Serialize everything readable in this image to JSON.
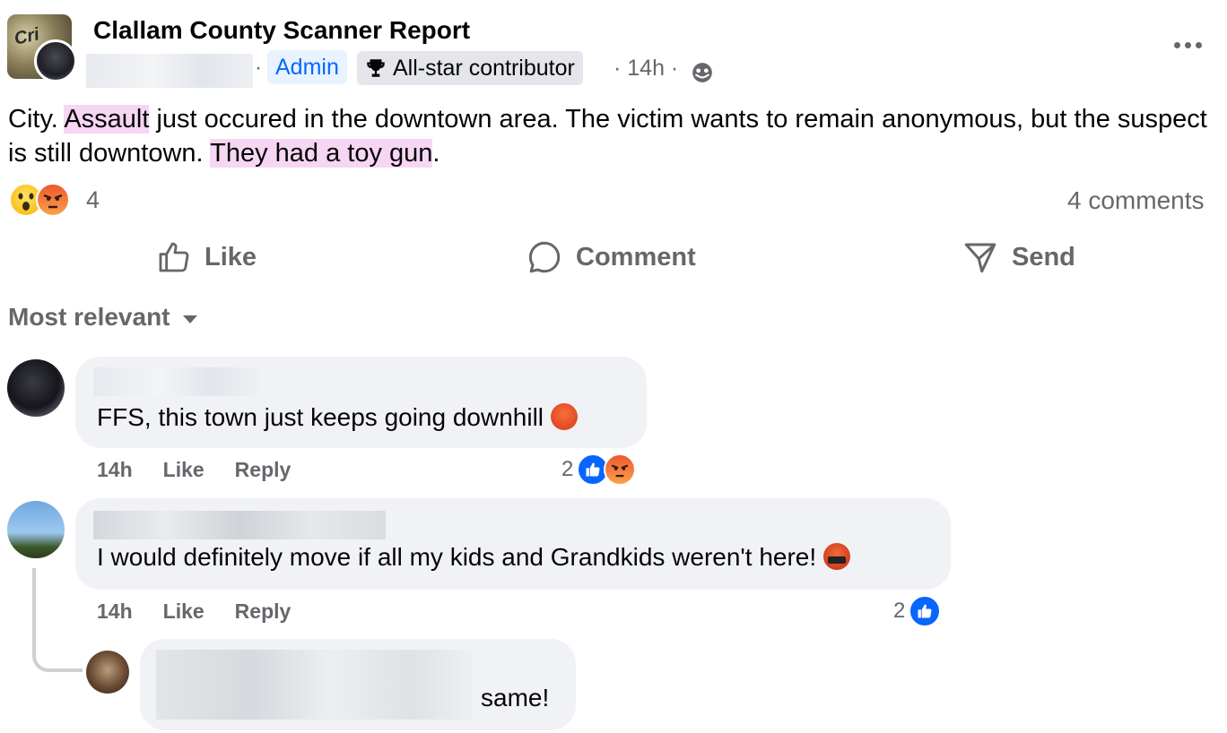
{
  "post": {
    "group_name": "Clallam County Scanner Report",
    "group_avatar_text": "Cri",
    "separator": "·",
    "admin_badge": "Admin",
    "allstar_badge": "All-star contributor",
    "time_meta": "· 14h ·",
    "audience_icon": "globe-icon",
    "text_parts": {
      "a": "City. ",
      "b": "Assault",
      "c": " just occured in the downtown area. The victim wants to remain anonymous,  but the suspect is still downtown.  ",
      "d": "They had a toy gun",
      "e": "."
    },
    "highlight_color": "#f6d6f3",
    "reactions": {
      "icons": [
        "wow-emoji",
        "angry-emoji"
      ],
      "count": "4"
    },
    "comments_count": "4 comments"
  },
  "actions": {
    "like": "Like",
    "comment": "Comment",
    "send": "Send"
  },
  "sort": {
    "label": "Most relevant"
  },
  "comments": [
    {
      "text": "FFS, this town just keeps going downhill",
      "emoji": "angry-face-emoji",
      "time": "14h",
      "like": "Like",
      "reply": "Reply",
      "reaction_count": "2",
      "reaction_icons": [
        "like-icon",
        "angry-emoji"
      ]
    },
    {
      "text": "I would definitely move if all my kids and Grandkids weren't here!",
      "emoji": "cursing-face-emoji",
      "time": "14h",
      "like": "Like",
      "reply": "Reply",
      "reaction_count": "2",
      "reaction_icons": [
        "like-icon"
      ]
    },
    {
      "text": "same!"
    }
  ],
  "colors": {
    "accent_blue": "#0866ff",
    "muted_text": "#65676b",
    "bubble_bg": "#f0f2f5",
    "admin_badge_bg": "#e7f3ff"
  }
}
